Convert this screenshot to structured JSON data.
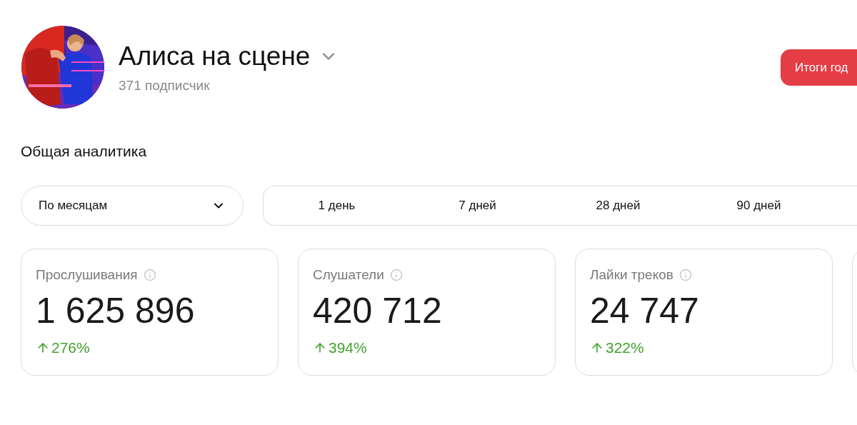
{
  "profile": {
    "name": "Алиса на сцене",
    "subscribers": "371 подписчик"
  },
  "summary_button": "Итоги год",
  "section_title": "Общая аналитика",
  "grouping_select": {
    "value": "По месяцам"
  },
  "periods": [
    {
      "label": "1 день",
      "selected": false
    },
    {
      "label": "7 дней",
      "selected": false
    },
    {
      "label": "28 дней",
      "selected": false
    },
    {
      "label": "90 дней",
      "selected": false
    }
  ],
  "stats": [
    {
      "label": "Прослушивания",
      "value": "1 625 896",
      "change": "276%",
      "kind": "up"
    },
    {
      "label": "Слушатели",
      "value": "420 712",
      "change": "394%",
      "kind": "up"
    },
    {
      "label": "Лайки треков",
      "value": "24 747",
      "change": "322%",
      "kind": "up"
    }
  ]
}
